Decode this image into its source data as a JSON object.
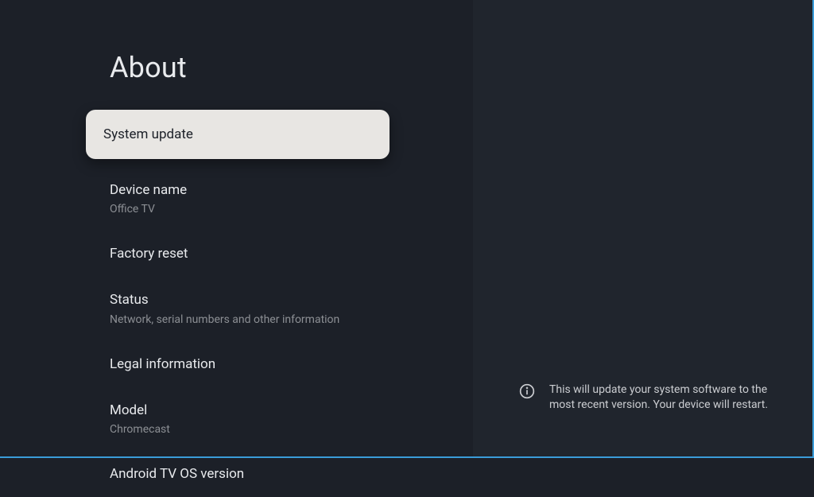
{
  "page": {
    "title": "About"
  },
  "menu": {
    "items": [
      {
        "title": "System update",
        "subtitle": ""
      },
      {
        "title": "Device name",
        "subtitle": "Office TV"
      },
      {
        "title": "Factory reset",
        "subtitle": ""
      },
      {
        "title": "Status",
        "subtitle": "Network, serial numbers and other information"
      },
      {
        "title": "Legal information",
        "subtitle": ""
      },
      {
        "title": "Model",
        "subtitle": "Chromecast"
      },
      {
        "title": "Android TV OS version",
        "subtitle": ""
      }
    ]
  },
  "info": {
    "text": "This will update your system software to the most recent version. Your device will restart."
  }
}
